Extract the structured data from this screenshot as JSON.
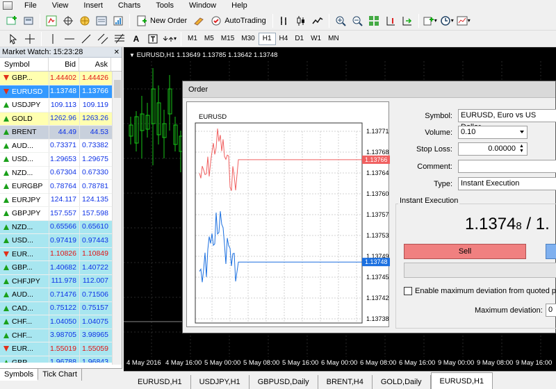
{
  "menu": [
    "File",
    "View",
    "Insert",
    "Charts",
    "Tools",
    "Window",
    "Help"
  ],
  "toolbar": {
    "new_order": "New Order",
    "autotrading": "AutoTrading",
    "timeframes": [
      "M1",
      "M5",
      "M15",
      "M30",
      "H1",
      "H4",
      "D1",
      "W1",
      "MN"
    ],
    "active_timeframe": "H1"
  },
  "market_watch": {
    "title": "Market Watch: 15:23:28",
    "headers": {
      "symbol": "Symbol",
      "bid": "Bid",
      "ask": "Ask"
    },
    "rows": [
      {
        "symbol": "GBP...",
        "bid": "1.44402",
        "ask": "1.44426",
        "dir": "dn",
        "bg": "yel"
      },
      {
        "symbol": "EURUSD",
        "bid": "1.13748",
        "ask": "1.13766",
        "dir": "dn",
        "bg": "sel"
      },
      {
        "symbol": "USDJPY",
        "bid": "109.113",
        "ask": "109.119",
        "dir": "up",
        "bg": ""
      },
      {
        "symbol": "GOLD",
        "bid": "1262.96",
        "ask": "1263.26",
        "dir": "up",
        "bg": "yel"
      },
      {
        "symbol": "BRENT",
        "bid": "44.49",
        "ask": "44.53",
        "dir": "up",
        "bg": "grey"
      },
      {
        "symbol": "AUD...",
        "bid": "0.73371",
        "ask": "0.73382",
        "dir": "up",
        "bg": ""
      },
      {
        "symbol": "USD...",
        "bid": "1.29653",
        "ask": "1.29675",
        "dir": "up",
        "bg": ""
      },
      {
        "symbol": "NZD...",
        "bid": "0.67304",
        "ask": "0.67330",
        "dir": "up",
        "bg": ""
      },
      {
        "symbol": "EURGBP",
        "bid": "0.78764",
        "ask": "0.78781",
        "dir": "up",
        "bg": ""
      },
      {
        "symbol": "EURJPY",
        "bid": "124.117",
        "ask": "124.135",
        "dir": "up",
        "bg": ""
      },
      {
        "symbol": "GBPJPY",
        "bid": "157.557",
        "ask": "157.598",
        "dir": "up",
        "bg": ""
      },
      {
        "symbol": "NZD...",
        "bid": "0.65566",
        "ask": "0.65610",
        "dir": "up",
        "bg": "cyan"
      },
      {
        "symbol": "USD...",
        "bid": "0.97419",
        "ask": "0.97443",
        "dir": "up",
        "bg": "cyan"
      },
      {
        "symbol": "EUR...",
        "bid": "1.10826",
        "ask": "1.10849",
        "dir": "dn",
        "bg": "cyan"
      },
      {
        "symbol": "GBP...",
        "bid": "1.40682",
        "ask": "1.40722",
        "dir": "up",
        "bg": "cyan"
      },
      {
        "symbol": "CHFJPY",
        "bid": "111.978",
        "ask": "112.007",
        "dir": "up",
        "bg": "cyan"
      },
      {
        "symbol": "AUD...",
        "bid": "0.71476",
        "ask": "0.71506",
        "dir": "up",
        "bg": "cyan"
      },
      {
        "symbol": "CAD...",
        "bid": "0.75122",
        "ask": "0.75157",
        "dir": "up",
        "bg": "cyan"
      },
      {
        "symbol": "CHF...",
        "bid": "1.04050",
        "ask": "1.04075",
        "dir": "up",
        "bg": "cyan"
      },
      {
        "symbol": "CHF...",
        "bid": "3.98705",
        "ask": "3.98965",
        "dir": "up",
        "bg": "cyan"
      },
      {
        "symbol": "EUR...",
        "bid": "1.55019",
        "ask": "1.55059",
        "dir": "dn",
        "bg": "cyan"
      },
      {
        "symbol": "GBP...",
        "bid": "1.96788",
        "ask": "1.96843",
        "dir": "up",
        "bg": "cyan"
      }
    ],
    "tabs": [
      "Symbols",
      "Tick Chart"
    ]
  },
  "chart": {
    "title": "EURUSD,H1  1.13649  1.13785  1.13642  1.13748",
    "x_labels": [
      "4 May 2016",
      "4 May 16:00",
      "5 May 00:00",
      "5 May 08:00",
      "5 May 16:00",
      "6 May 00:00",
      "6 May 08:00",
      "6 May 16:00",
      "9 May 00:00",
      "9 May 08:00",
      "9 May 16:00"
    ],
    "tabs": [
      "EURUSD,H1",
      "USDJPY,H1",
      "GBPUSD,Daily",
      "BRENT,H4",
      "GOLD,Daily",
      "EURUSD,H1"
    ],
    "active_tab": 5
  },
  "order_dialog": {
    "title": "Order",
    "tick_chart_symbol": "EURUSD",
    "y_labels": [
      "1.13771",
      "1.13768",
      "1.13764",
      "1.13760",
      "1.13757",
      "1.13753",
      "1.13749",
      "1.13745",
      "1.13742",
      "1.13738"
    ],
    "ask_tag": "1.13766",
    "bid_tag": "1.13748",
    "labels": {
      "symbol": "Symbol:",
      "volume": "Volume:",
      "stop_loss": "Stop Loss:",
      "comment": "Comment:",
      "type": "Type:"
    },
    "values": {
      "symbol": "EURUSD, Euro vs US Dollar",
      "volume": "0.10",
      "stop_loss": "0.00000",
      "comment": "",
      "type": "Instant Execution"
    },
    "group_title": "Instant Execution",
    "price_main": "1.1374",
    "price_sup": "8",
    "price_sep": " / 1.",
    "sell_label": "Sell",
    "max_dev_check": "Enable maximum deviation from quoted price",
    "max_dev_label": "Maximum deviation:",
    "max_dev_value": "0"
  },
  "colors": {
    "ask_line": "#f06060",
    "bid_line": "#1a6fe0",
    "candle_up": "#17c617",
    "chart_bg": "#000000"
  }
}
